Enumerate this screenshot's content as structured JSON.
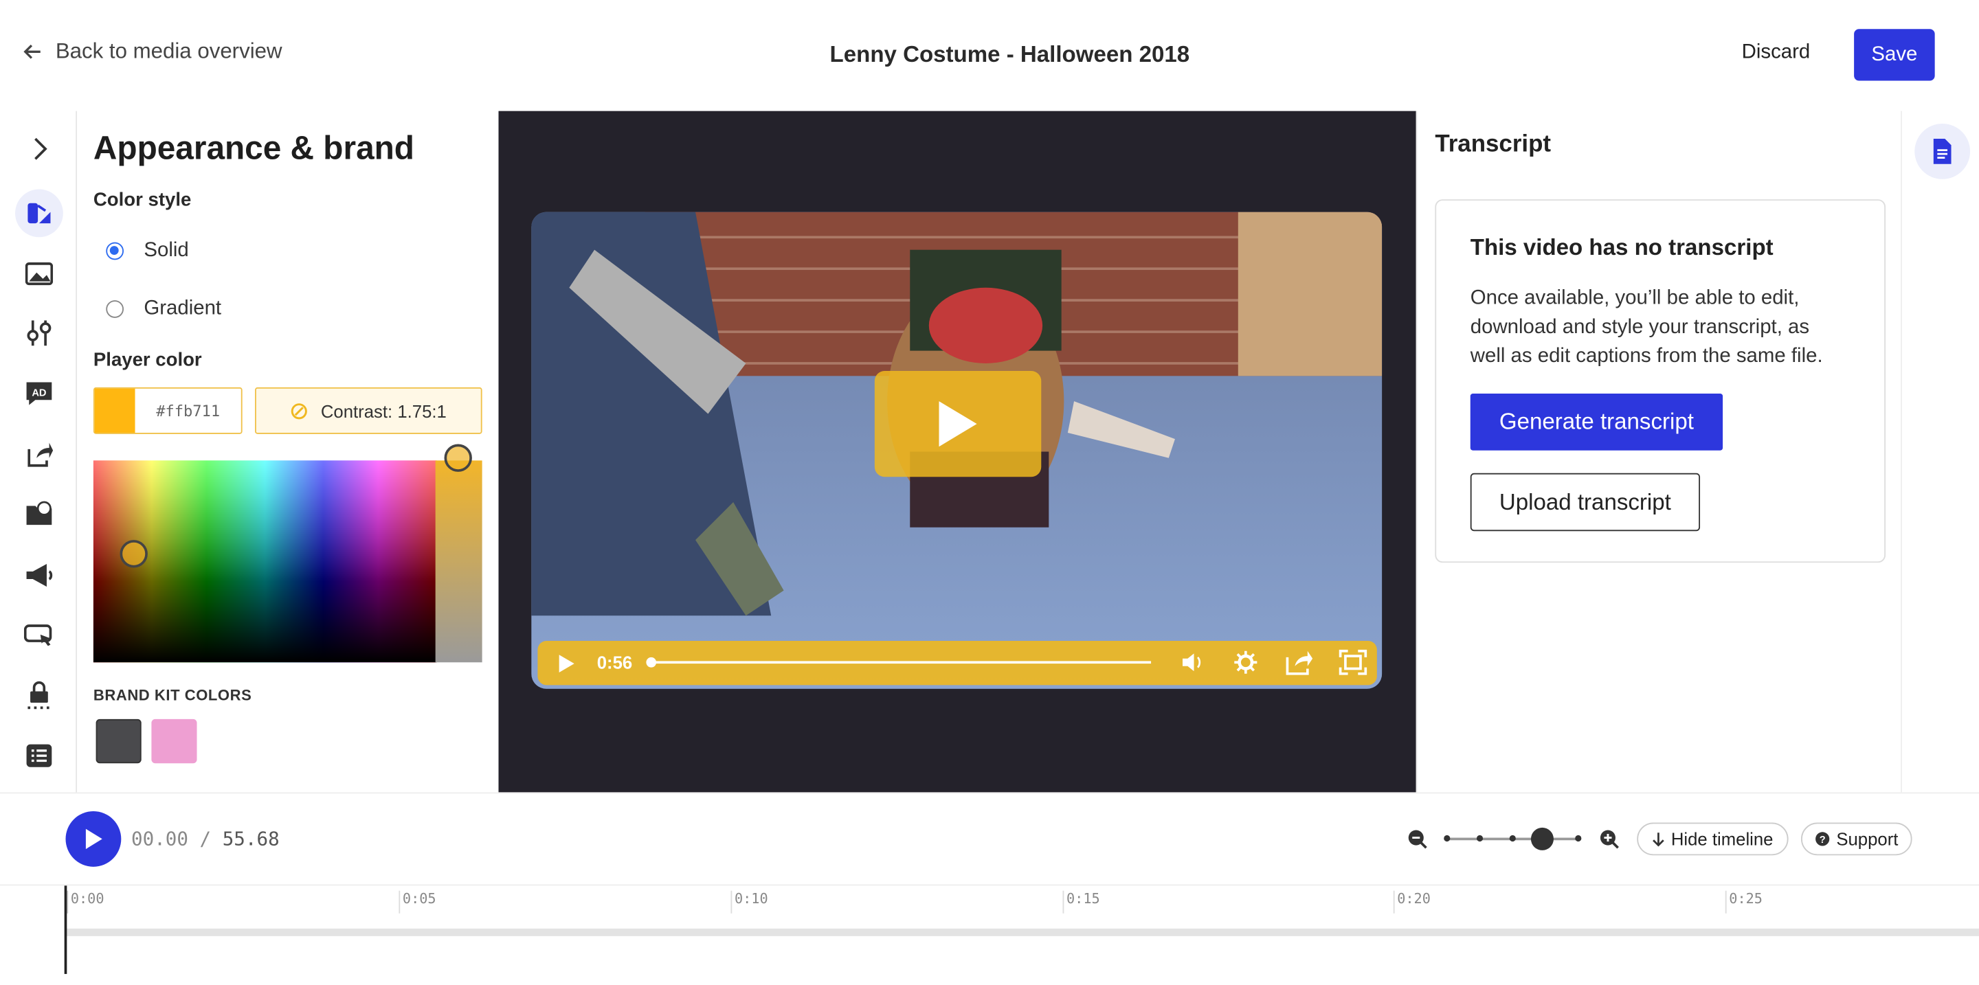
{
  "header": {
    "back_label": "Back to media overview",
    "title": "Lenny Costume - Halloween 2018",
    "discard_label": "Discard",
    "save_label": "Save"
  },
  "rail": {
    "icons": [
      "chevron-right-icon",
      "appearance-icon",
      "image-icon",
      "sliders-icon",
      "ad-icon",
      "share-icon",
      "folder-link-icon",
      "megaphone-icon",
      "cursor-chat-icon",
      "lock-icon",
      "list-icon"
    ],
    "active": "appearance-icon"
  },
  "panel": {
    "heading": "Appearance & brand",
    "color_style_label": "Color style",
    "options": [
      "Solid",
      "Gradient"
    ],
    "selected_option": "Solid",
    "player_color_label": "Player color",
    "hex_value": "#ffb711",
    "contrast_label": "Contrast: 1.75:1",
    "brand_kit_label": "BRAND KIT COLORS",
    "brand_colors": [
      "#4a4a4d",
      "#ee9fd2"
    ]
  },
  "video": {
    "time": "0:56",
    "progress": 0
  },
  "transcript": {
    "title": "Transcript",
    "card_title": "This video has no transcript",
    "card_body": "Once available, you’ll be able to edit, download and style your transcript, as well as edit captions from the same file.",
    "generate_label": "Generate transcript",
    "upload_label": "Upload transcript"
  },
  "timeline": {
    "current_time": "00.00",
    "separator": "/",
    "total_time": "55.68",
    "hide_label": "Hide timeline",
    "support_label": "Support",
    "ticks": [
      "0:00",
      "0:05",
      "0:10",
      "0:15",
      "0:20",
      "0:25"
    ]
  },
  "colors": {
    "accent": "#2d37dd",
    "player": "#ffb711",
    "stage": "#24222b"
  }
}
